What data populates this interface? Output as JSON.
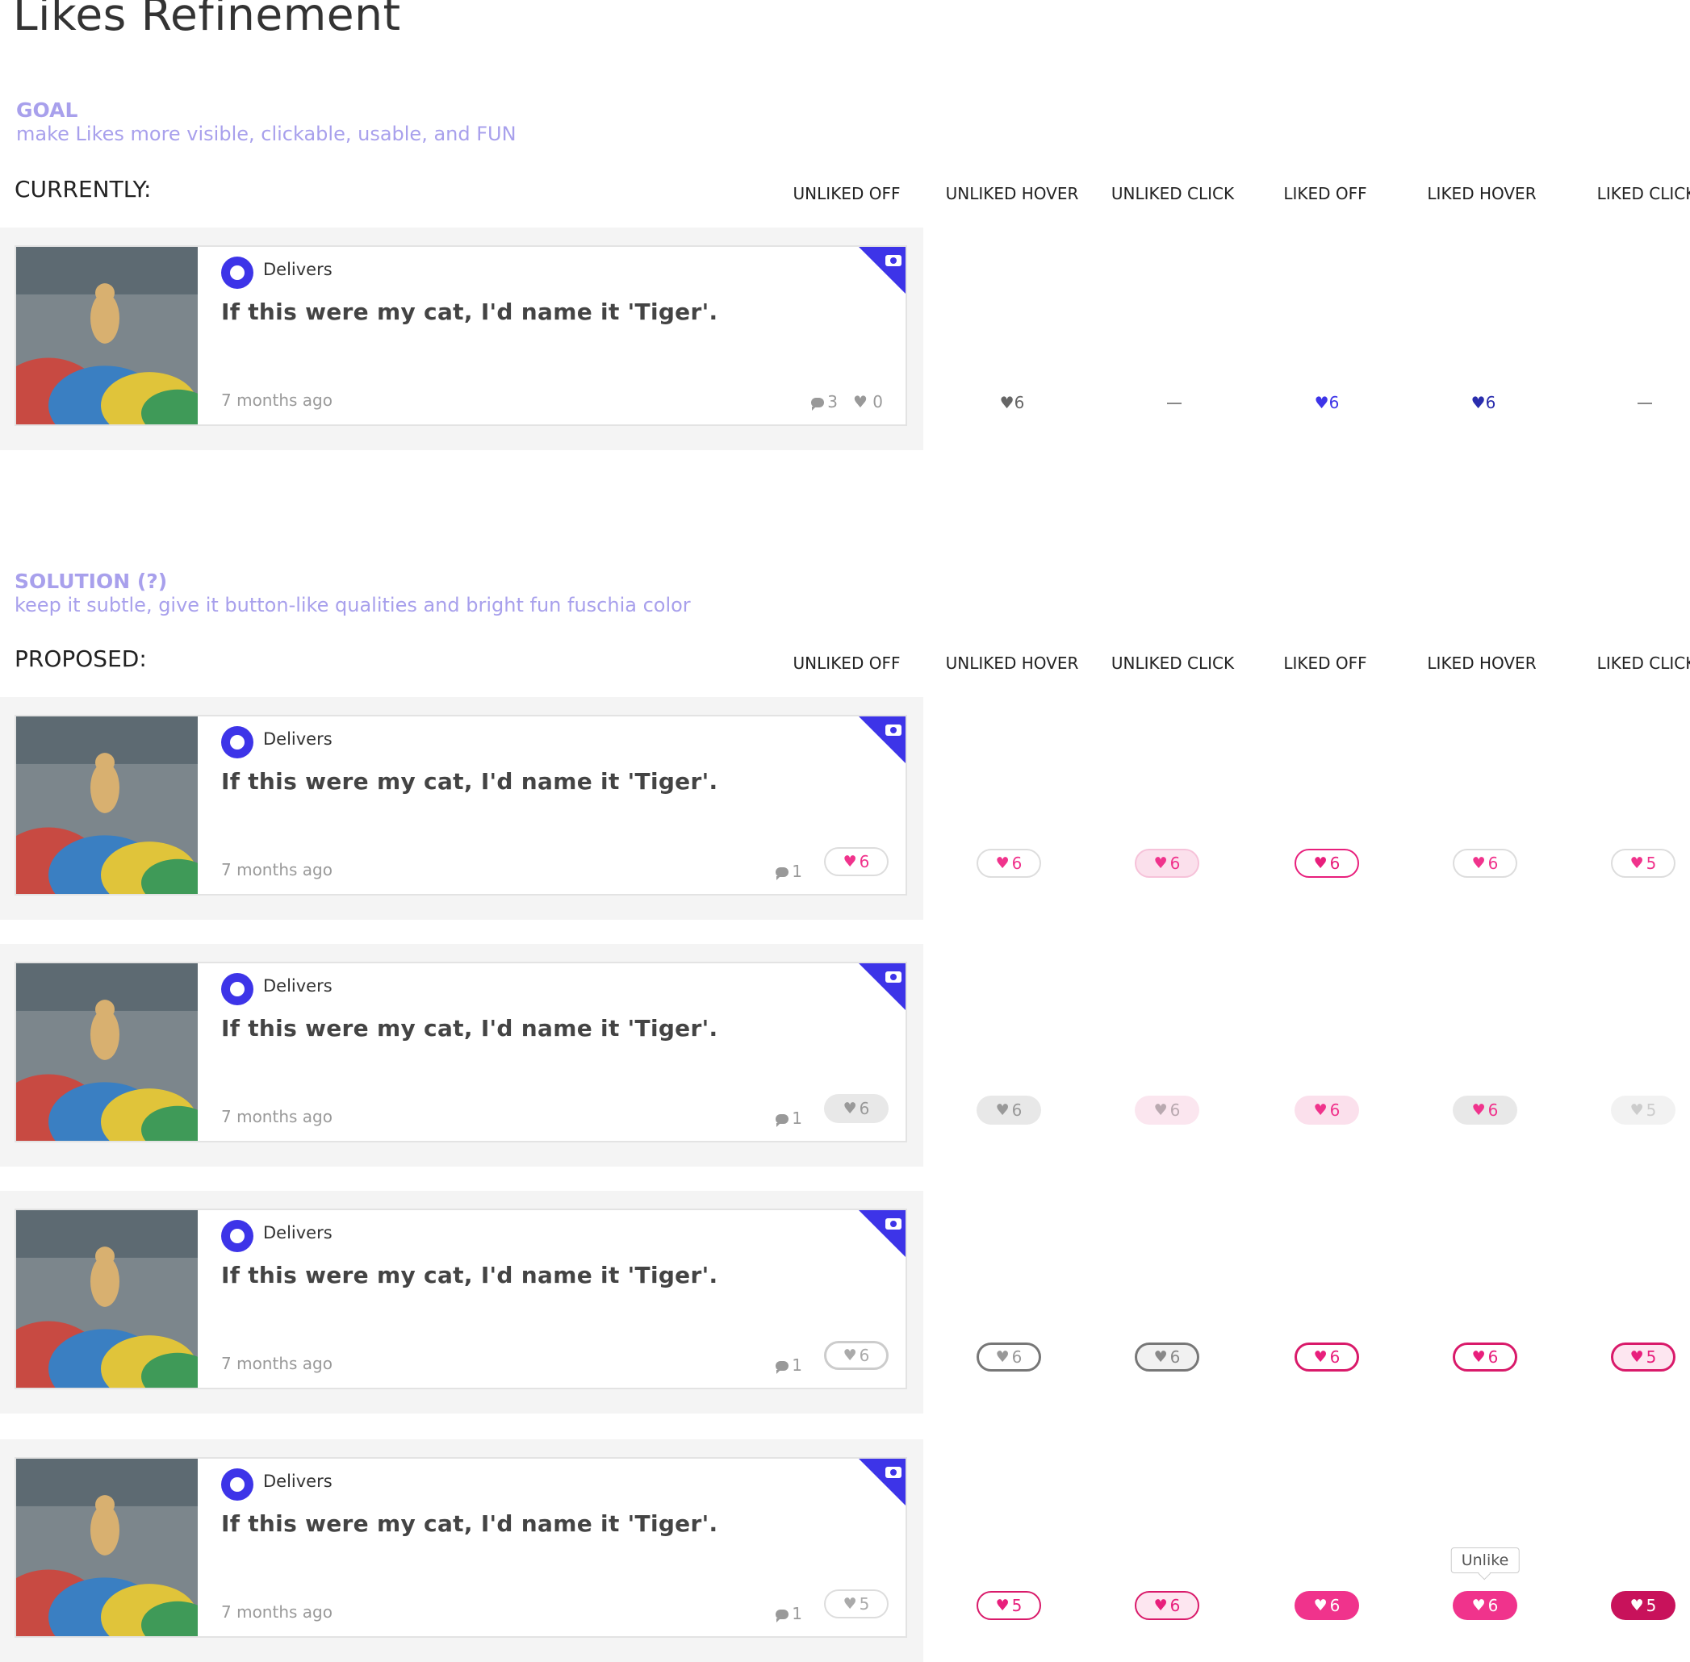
{
  "page_title": "Likes Refinement",
  "goal": {
    "label": "GOAL",
    "text": "make Likes more visible, clickable, usable, and FUN"
  },
  "solution": {
    "label": "SOLUTION (?)",
    "text": "keep it subtle, give it button-like qualities and bright fun fuschia color"
  },
  "columns": [
    "UNLIKED OFF",
    "UNLIKED HOVER",
    "UNLIKED CLICK",
    "LIKED OFF",
    "LIKED HOVER",
    "LIKED CLICK"
  ],
  "currently": {
    "title": "CURRENTLY:",
    "card": {
      "brand": "Delivers",
      "post": "If this were my cat, I'd name it 'Tiger'.",
      "time": "7 months ago",
      "comments": "3",
      "likes": "0"
    },
    "states": [
      "6",
      "—",
      "6",
      "6",
      "—"
    ]
  },
  "proposed": {
    "title": "PROPOSED:",
    "rows": [
      {
        "card": {
          "brand": "Delivers",
          "post": "If this were my cat, I'd name it 'Tiger'.",
          "time": "7 months ago",
          "comments": "1",
          "likes": "6"
        },
        "states": [
          "6",
          "6",
          "6",
          "6",
          "5"
        ]
      },
      {
        "card": {
          "brand": "Delivers",
          "post": "If this were my cat, I'd name it 'Tiger'.",
          "time": "7 months ago",
          "comments": "1",
          "likes": "6"
        },
        "states": [
          "6",
          "6",
          "6",
          "6",
          "5"
        ]
      },
      {
        "card": {
          "brand": "Delivers",
          "post": "If this were my cat, I'd name it 'Tiger'.",
          "time": "7 months ago",
          "comments": "1",
          "likes": "6"
        },
        "states": [
          "6",
          "6",
          "6",
          "6",
          "5"
        ]
      },
      {
        "card": {
          "brand": "Delivers",
          "post": "If this were my cat, I'd name it 'Tiger'.",
          "time": "7 months ago",
          "comments": "1",
          "likes": "5"
        },
        "states": [
          "5",
          "6",
          "6",
          "6",
          "5"
        ],
        "tooltip": "Unlike"
      }
    ]
  },
  "icons": {
    "heart": "heart-icon",
    "comment": "comment-icon",
    "camera": "camera-icon"
  },
  "colors": {
    "accent_purple": "#3d34e8",
    "heading_lavender": "#a8a0ec",
    "fuchsia": "#f0338c",
    "deep_fuchsia": "#c8125b"
  }
}
